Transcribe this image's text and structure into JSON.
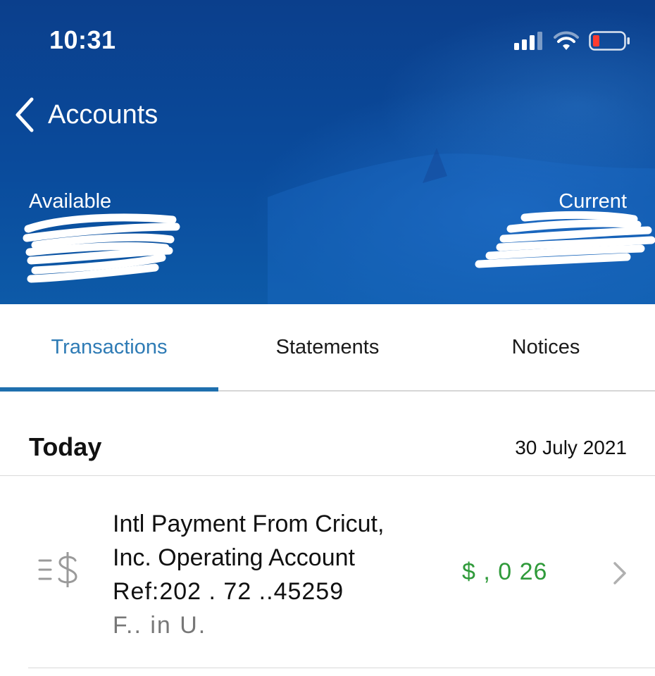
{
  "status_bar": {
    "time": "10:31"
  },
  "nav": {
    "back_label": "Accounts"
  },
  "balances": {
    "available_label": "Available",
    "current_label": "Current"
  },
  "tabs": [
    {
      "label": "Transactions",
      "active": true
    },
    {
      "label": "Statements",
      "active": false
    },
    {
      "label": "Notices",
      "active": false
    }
  ],
  "section": {
    "title": "Today",
    "date": "30 July 2021"
  },
  "transaction": {
    "line1": "Intl Payment From Cricut,",
    "line2": "Inc. Operating Account",
    "ref": "Ref:202 . 72  ..45259",
    "line4": "F.. in U.",
    "amount": "$ ,   0 26",
    "amount_color": "#2f9a3a"
  },
  "icons": {
    "signal": "signal-icon",
    "wifi": "wifi-icon",
    "battery": "battery-icon",
    "back": "chevron-left-icon",
    "transaction": "dollar-lines-icon",
    "detail": "chevron-right-icon"
  }
}
